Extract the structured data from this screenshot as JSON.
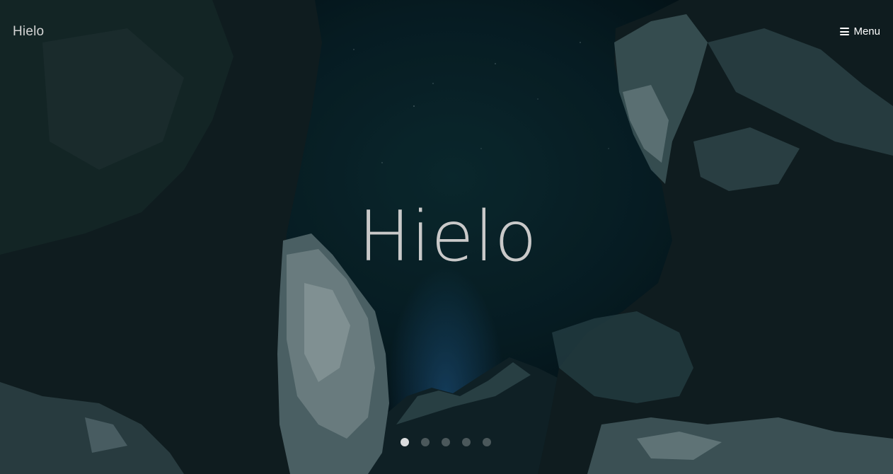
{
  "header": {
    "logo": "Hielo",
    "menu_label": "Menu"
  },
  "hero": {
    "title": "Hielo"
  },
  "pager": {
    "dot_count": 5,
    "active_index": 0
  },
  "colors": {
    "sky": "#08222a",
    "rock": "#0f2125",
    "snow": "#a9c0c4",
    "glow": "#2a6faa",
    "title_text": "#c9c9c9"
  },
  "icons": {
    "menu": "hamburger-icon"
  }
}
